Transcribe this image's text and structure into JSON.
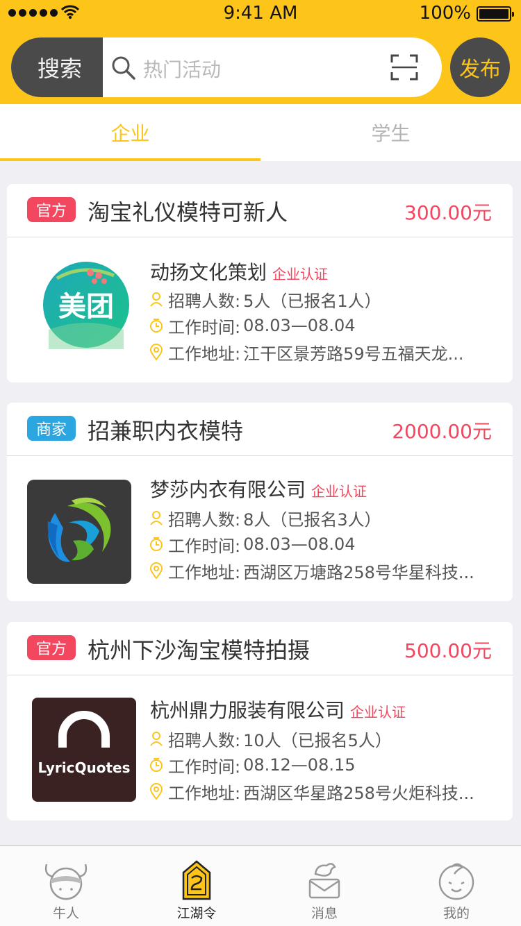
{
  "status_bar": {
    "time": "9:41 AM",
    "battery": "100%"
  },
  "search": {
    "label": "搜索",
    "placeholder": "热门活动",
    "publish_label": "发布"
  },
  "tabs": [
    {
      "label": "企业",
      "active": true
    },
    {
      "label": "学生",
      "active": false
    }
  ],
  "labels": {
    "verified": "企业认证",
    "recruit": "招聘人数:",
    "time": "工作时间:",
    "address": "工作地址:"
  },
  "jobs": [
    {
      "tag": "官方",
      "tag_color": "#f2475f",
      "title": "淘宝礼仪模特可新人",
      "salary": "300.00元",
      "company": "动扬文化策划",
      "logo_icon": "meituan-logo",
      "logo_text": "美团",
      "recruit": "5人（已报名1人）",
      "time": "08.03—08.04",
      "address": "江干区景芳路59号五福天龙..."
    },
    {
      "tag": "商家",
      "tag_color": "#2ba6e1",
      "title": "招兼职内衣模特",
      "salary": "2000.00元",
      "company": "梦莎内衣有限公司",
      "logo_icon": "swirl-logo",
      "recruit": "8人（已报名3人）",
      "time": "08.03—08.04",
      "address": "西湖区万塘路258号华星科技..."
    },
    {
      "tag": "官方",
      "tag_color": "#f2475f",
      "title": "杭州下沙淘宝模特拍摄",
      "salary": "500.00元",
      "company": "杭州鼎力服装有限公司",
      "logo_icon": "lyricquotes-logo",
      "logo_text": "LyricQuotes",
      "recruit": "10人（已报名5人）",
      "time": "08.12—08.15",
      "address": "西湖区华星路258号火炬科技..."
    }
  ],
  "tabbar": [
    {
      "label": "牛人",
      "icon": "bull-icon",
      "active": false
    },
    {
      "label": "江湖令",
      "icon": "token-icon",
      "active": true
    },
    {
      "label": "消息",
      "icon": "message-bird-icon",
      "active": false
    },
    {
      "label": "我的",
      "icon": "profile-face-icon",
      "active": false
    }
  ],
  "colors": {
    "accent": "#fdc51a",
    "price": "#f2475f",
    "dark": "#4a4a4a"
  }
}
